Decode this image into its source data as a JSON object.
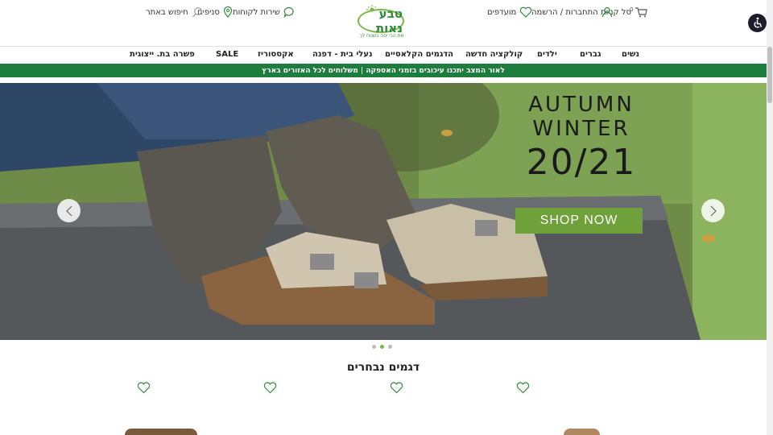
{
  "header": {
    "cart_label": "סל קניות",
    "cart_count": "0",
    "favorites_label": "מועדפים",
    "login_label": "התחברות / הרשמה",
    "service_label": "שירות לקוחות",
    "stores_label": "סניפים",
    "search_label": "חיפוש באתר",
    "logo_text": "טבע נאות",
    "logo_tagline": "את הכי יפה כשנוח לך"
  },
  "nav": {
    "items": [
      "נשים",
      "גברים",
      "ילדים",
      "קולקציה חדשה",
      "הדגמים הקלאסיים",
      "נעלי בית - דפנה",
      "אקססוריז",
      "SALE",
      "פשרה בת. ייצוגית"
    ]
  },
  "banner": {
    "text": "לאור המצב יתכנו עיכובים בזמני האספקה | משלוחים לכל האזורים בארץ"
  },
  "hero": {
    "line1": "AUTUMN",
    "line2": "WINTER",
    "line3": "20/21",
    "cta": "SHOP NOW",
    "active_slide": 2,
    "slide_count": 3
  },
  "featured": {
    "title": "דגמים נבחרים"
  },
  "colors": {
    "brand_green": "#1d7d3c",
    "accent_green": "#7ab648",
    "shop_button": "#6fa13a"
  }
}
